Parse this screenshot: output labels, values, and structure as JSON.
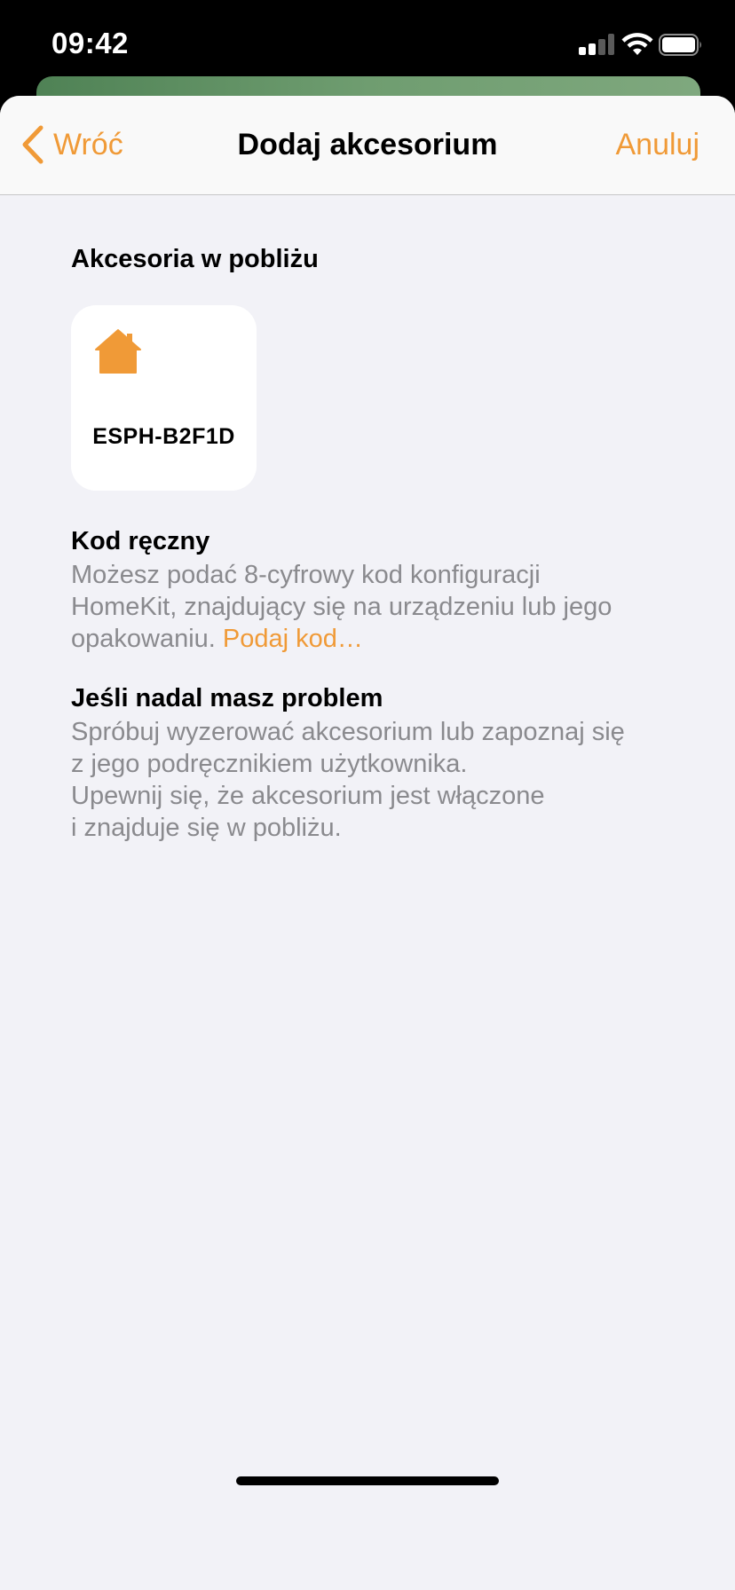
{
  "status_bar": {
    "time": "09:42"
  },
  "navbar": {
    "back_label": "Wróć",
    "title": "Dodaj akcesorium",
    "cancel_label": "Anuluj"
  },
  "nearby": {
    "heading": "Akcesoria w pobliżu",
    "accessories": [
      {
        "name": "ESPH-B2F1D",
        "icon": "house-icon"
      }
    ]
  },
  "manual_code": {
    "heading": "Kod ręczny",
    "lines": [
      "Możesz podać 8-cyfrowy kod konfiguracji",
      "HomeKit, znajdujący się na urządzeniu lub jego",
      "opakowaniu."
    ],
    "link": "Podaj kod…"
  },
  "problem": {
    "heading": "Jeśli nadal masz problem",
    "lines": [
      "Spróbuj wyzerować akcesorium lub zapoznaj się",
      "z jego podręcznikiem użytkownika.",
      "Upewnij się, że akcesorium jest włączone",
      "i znajduje się w pobliżu."
    ]
  },
  "colors": {
    "accent": "#f09a37",
    "background": "#f2f2f7",
    "secondary_text": "#8a8a8e"
  }
}
